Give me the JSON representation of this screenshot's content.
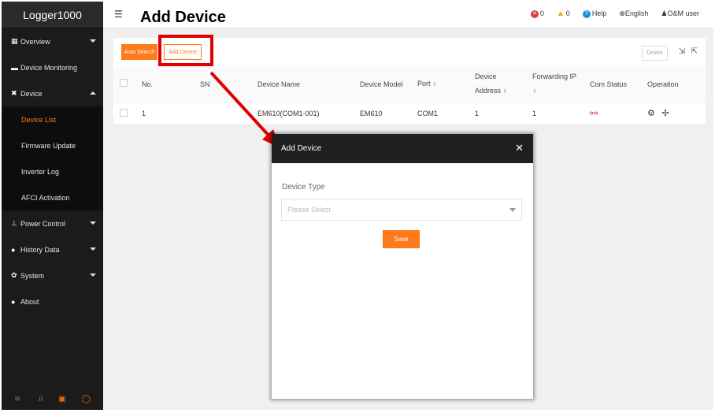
{
  "sidebar": {
    "logo": "Logger1000",
    "items": [
      {
        "label": "Overview",
        "icon": "grid-icon"
      },
      {
        "label": "Device Monitoring",
        "icon": "monitor-icon"
      },
      {
        "label": "Device",
        "icon": "tools-icon"
      },
      {
        "label": "Power Control",
        "icon": "plug-icon"
      },
      {
        "label": "History Data",
        "icon": "clock-icon"
      },
      {
        "label": "System",
        "icon": "gear-icon"
      },
      {
        "label": "About",
        "icon": "info-icon"
      }
    ],
    "device_sub": [
      "Device List",
      "Firmware Update",
      "Inverter Log",
      "AFCI Activation"
    ]
  },
  "header": {
    "title": "Add Device",
    "fault_count": "0",
    "warning_count": "0",
    "help": "Help",
    "language": "English",
    "user": "O&M user"
  },
  "toolbar": {
    "auto_search": "Auto Search",
    "add_device": "Add Device",
    "delete": "Delete"
  },
  "table": {
    "headers": {
      "no": "No.",
      "sn": "SN",
      "device_name": "Device Name",
      "device_model": "Device Model",
      "port": "Port",
      "device_address_1": "Device",
      "device_address_2": "Address",
      "forwarding_ip": "Forwarding IP",
      "com_status": "Com Status",
      "operation": "Operation"
    },
    "rows": [
      {
        "no": "1",
        "sn": "",
        "device_name": "EM610(COM1-001)",
        "device_model": "EM610",
        "port": "COM1",
        "device_address": "1",
        "forwarding_ip": "1"
      }
    ]
  },
  "modal": {
    "title": "Add Device",
    "field_label": "Device Type",
    "select_placeholder": "Please Select",
    "save": "Save"
  },
  "colors": {
    "accent": "#ff7a1a",
    "annotation": "#e00000"
  }
}
